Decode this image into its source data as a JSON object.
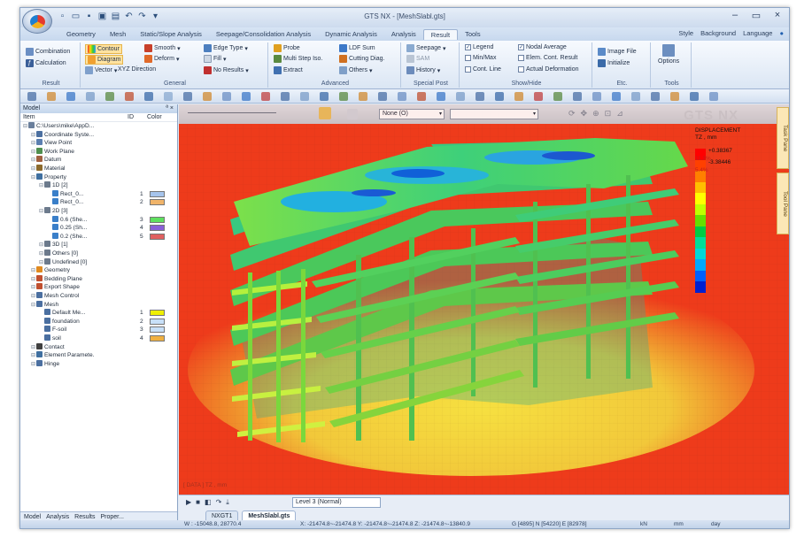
{
  "window": {
    "title": "GTS NX - [MeshSlabl.gts]"
  },
  "ribbon_tabs": [
    "Geometry",
    "Mesh",
    "Static/Slope Analysis",
    "Seepage/Consolidation Analysis",
    "Dynamic Analysis",
    "Analysis",
    "Result",
    "Tools"
  ],
  "active_tab": "Result",
  "ribbon_right": [
    "Style",
    "Background",
    "Language"
  ],
  "ribbon": {
    "result": {
      "label": "Result",
      "combination": "Combination",
      "calculation": "Calculation"
    },
    "general": {
      "label": "General",
      "contour": "Contour",
      "smooth": "Smooth",
      "edge_type": "Edge Type",
      "diagram": "Diagram",
      "deform": "Deform",
      "fill": "Fill",
      "vector": "Vector",
      "xyz_direction": "XYZ Direction",
      "no_results": "No Results"
    },
    "advanced": {
      "label": "Advanced",
      "probe": "Probe",
      "ldf_sum": "LDF Sum",
      "multi_step_iso": "Multi Step Iso.",
      "cutting_diag": "Cutting Diag.",
      "extract": "Extract",
      "others": "Others"
    },
    "special_post": {
      "label": "Special Post",
      "seepage": "Seepage",
      "sam": "SAM",
      "history": "History"
    },
    "show_hide": {
      "label": "Show/Hide",
      "legend": "Legend",
      "nodal_average": "Nodal Average",
      "min_max": "Min/Max",
      "elem_cont_result": "Elem. Cont. Result",
      "cont_line": "Cont. Line",
      "actual_deformation": "Actual Deformation"
    },
    "etc": {
      "label": "Etc.",
      "image_file": "Image File",
      "initialize": "Initialize"
    },
    "tools": {
      "label": "Tools",
      "options": "Options"
    }
  },
  "model_panel": {
    "title": "Model",
    "columns": {
      "item": "Item",
      "id": "ID",
      "color": "Color"
    },
    "tree": [
      {
        "label": "C:\\Users\\mike\\AppD...",
        "indent": 0,
        "icon": "#6a7f9c"
      },
      {
        "label": "Coordinate Syste...",
        "indent": 1,
        "icon": "#4b6fa0"
      },
      {
        "label": "View Point",
        "indent": 1,
        "icon": "#5b7fb0"
      },
      {
        "label": "Work Plane",
        "indent": 1,
        "icon": "#4f8f4f"
      },
      {
        "label": "Datum",
        "indent": 1,
        "icon": "#a06040"
      },
      {
        "label": "Material",
        "indent": 1,
        "icon": "#8c6a2c"
      },
      {
        "label": "Property",
        "indent": 1,
        "icon": "#3f6fa0"
      },
      {
        "label": "1D [2]",
        "indent": 2,
        "icon": "#6c7a8c"
      },
      {
        "label": "Rect_0...",
        "indent": 3,
        "icon": "#3a7fc9",
        "id": "1",
        "color": "#a6c4ec"
      },
      {
        "label": "Rect_0...",
        "indent": 3,
        "icon": "#3a7fc9",
        "id": "2",
        "color": "#f0b46a"
      },
      {
        "label": "2D [3]",
        "indent": 2,
        "icon": "#6c7a8c"
      },
      {
        "label": "0.6 (She...",
        "indent": 3,
        "icon": "#3a7fc9",
        "id": "3",
        "color": "#5fe05f"
      },
      {
        "label": "0.25 (Sh...",
        "indent": 3,
        "icon": "#3a7fc9",
        "id": "4",
        "color": "#8a5fd8"
      },
      {
        "label": "0.2 (She...",
        "indent": 3,
        "icon": "#3a7fc9",
        "id": "5",
        "color": "#e06060"
      },
      {
        "label": "3D [1]",
        "indent": 2,
        "icon": "#6c7a8c"
      },
      {
        "label": "Others [0]",
        "indent": 2,
        "icon": "#6c7a8c"
      },
      {
        "label": "Undefined [0]",
        "indent": 2,
        "icon": "#6c7a8c"
      },
      {
        "label": "Geometry",
        "indent": 1,
        "icon": "#e08a20"
      },
      {
        "label": "Bedding Plane",
        "indent": 1,
        "icon": "#c05030"
      },
      {
        "label": "Export Shape",
        "indent": 1,
        "icon": "#c05030"
      },
      {
        "label": "Mesh Control",
        "indent": 1,
        "icon": "#4b6fa0"
      },
      {
        "label": "Mesh",
        "indent": 1,
        "icon": "#4b6fa0"
      },
      {
        "label": "Default Me...",
        "indent": 2,
        "icon": "#4b6fa0",
        "id": "1",
        "color": "#f0f000"
      },
      {
        "label": "foundation",
        "indent": 2,
        "icon": "#4b6fa0",
        "id": "2",
        "color": "#c8e0f8"
      },
      {
        "label": "F-soil",
        "indent": 2,
        "icon": "#4b6fa0",
        "id": "3",
        "color": "#c8e0f8"
      },
      {
        "label": "soil",
        "indent": 2,
        "icon": "#4b6fa0",
        "id": "4",
        "color": "#f0b040"
      },
      {
        "label": "Contact",
        "indent": 1,
        "icon": "#404040"
      },
      {
        "label": "Element Paramete.",
        "indent": 1,
        "icon": "#3f6fa0"
      },
      {
        "label": "Hinge",
        "indent": 1,
        "icon": "#4b6fa0"
      }
    ],
    "bottom_tabs": [
      "Model",
      "Analysis",
      "Results",
      "Proper..."
    ]
  },
  "viewport": {
    "view_combo": "None (O)",
    "logo": "GTS NX",
    "legend": {
      "title": "DISPLACEMENT",
      "component": "TZ , mm",
      "pct_top": "11.3%",
      "pct_second": "5.4%",
      "values": [
        "+0.38367",
        "-3.38446"
      ],
      "colors": [
        "#ff0000",
        "#ff4000",
        "#ff8000",
        "#ffbf00",
        "#ffff00",
        "#bfff00",
        "#66e000",
        "#00cc44",
        "#00dd99",
        "#00d8d8",
        "#00a8ff",
        "#0060ff",
        "#0020d0"
      ]
    },
    "status_text": "[ DATA ] TZ , mm"
  },
  "document": {
    "level": "Level 3 (Normal)",
    "tabs": [
      "NXGT1",
      "MeshSlabl.gts"
    ],
    "active": "MeshSlabl.gts"
  },
  "statusbar": {
    "coords": "W : -15048.8, 28770.4",
    "extent": "X: -21474.8~-21474.8 Y: -21474.8~-21474.8 Z: -21474.8~-13840.9",
    "counts": "G [4895] N [54220] E [82978]",
    "unit_force": "kN",
    "unit_length": "mm",
    "unit_time": "day"
  },
  "side_pins": [
    "Task Pane",
    "Tool Pane"
  ]
}
